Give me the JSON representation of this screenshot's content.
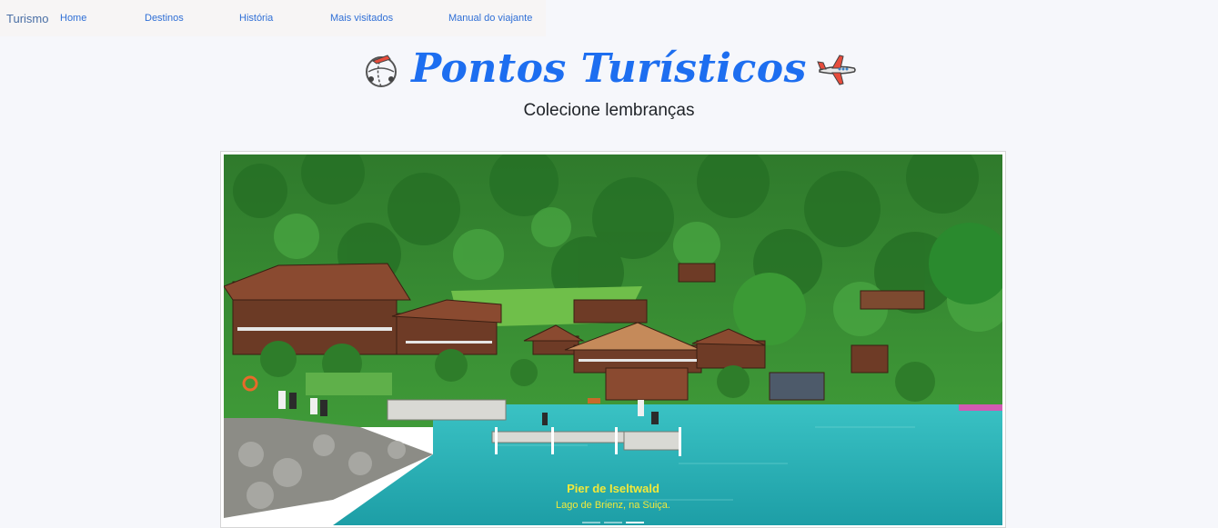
{
  "nav": {
    "brand": "Turismo",
    "links": [
      "Home",
      "Destinos",
      "História",
      "Mais visitados",
      "Manual do viajante"
    ]
  },
  "header": {
    "title": "Pontos Turísticos",
    "subtitle": "Colecione lembranças",
    "left_icon": "globe-travel-icon",
    "right_icon": "airplane-icon"
  },
  "carousel": {
    "slide_title": "Pier de Iseltwald",
    "slide_text": "Lago de Brienz, na Suiça.",
    "indicator_count": 3,
    "active_index": 2
  },
  "colors": {
    "accent": "#1d6ef0",
    "caption": "#f2e93a",
    "lake": "#2bb3b7"
  }
}
